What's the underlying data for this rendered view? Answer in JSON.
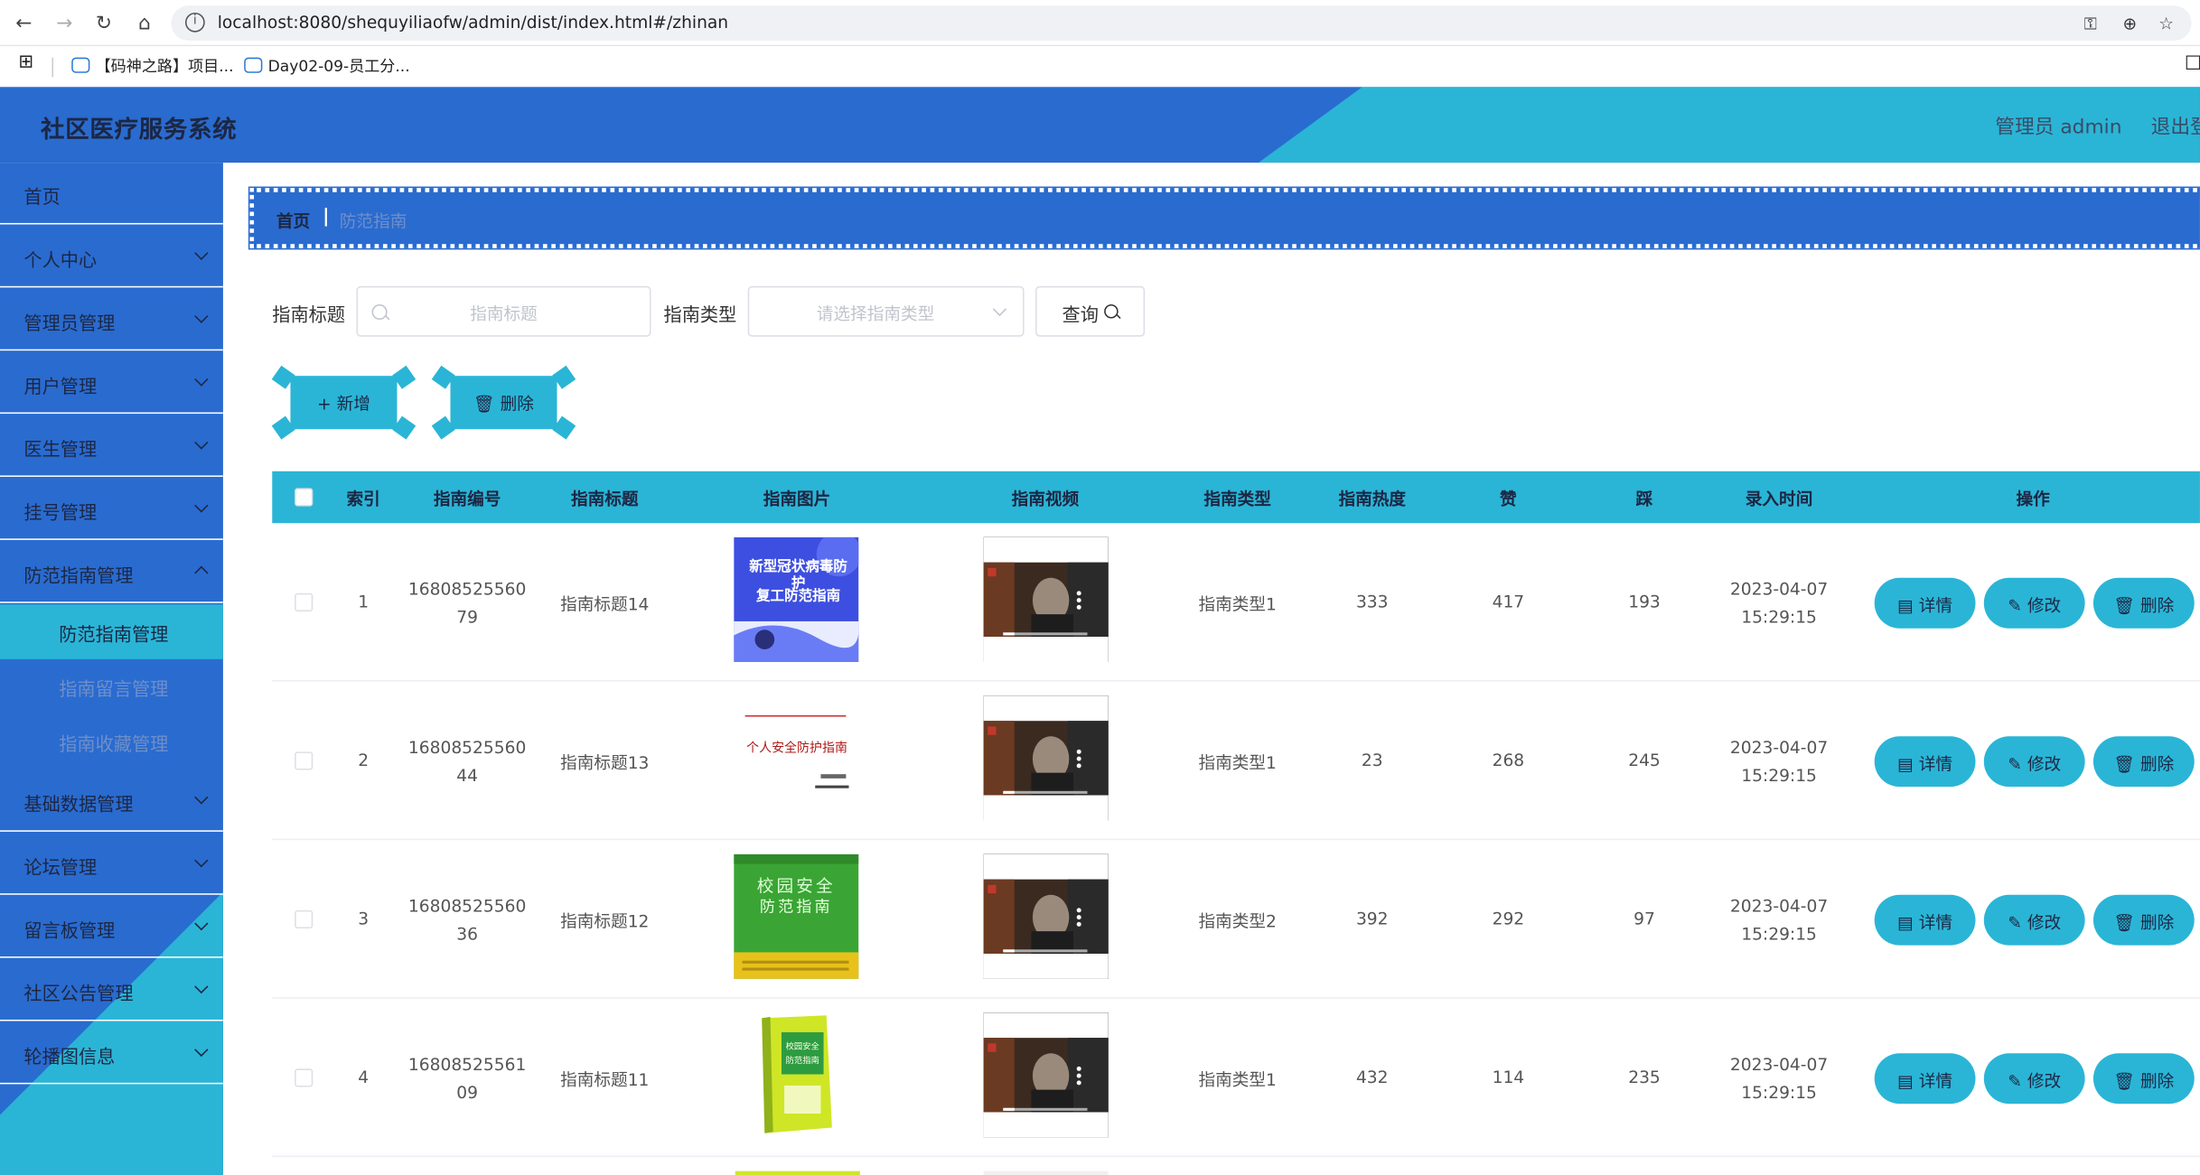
{
  "browser": {
    "url": "localhost:8080/shequyiliaofw/admin/dist/index.html#/zhinan",
    "bookmarks": [
      "【码神之路】项目...",
      "Day02-09-员工分..."
    ]
  },
  "header": {
    "title": "社区医疗服务系统",
    "user": "管理员 admin",
    "logout": "退出登"
  },
  "colors": {
    "primary": "#2a6bcf",
    "accent": "#2ab5d6",
    "text_dark": "#1c2744"
  },
  "sidebar": {
    "items": [
      {
        "label": "首页",
        "expandable": false
      },
      {
        "label": "个人中心",
        "expandable": true
      },
      {
        "label": "管理员管理",
        "expandable": true
      },
      {
        "label": "用户管理",
        "expandable": true
      },
      {
        "label": "医生管理",
        "expandable": true
      },
      {
        "label": "挂号管理",
        "expandable": true
      },
      {
        "label": "防范指南管理",
        "expandable": true,
        "expanded": true
      },
      {
        "label": "基础数据管理",
        "expandable": true
      },
      {
        "label": "论坛管理",
        "expandable": true
      },
      {
        "label": "留言板管理",
        "expandable": true
      },
      {
        "label": "社区公告管理",
        "expandable": true
      },
      {
        "label": "轮播图信息",
        "expandable": true
      }
    ],
    "subitems": [
      {
        "label": "防范指南管理",
        "active": true
      },
      {
        "label": "指南留言管理",
        "active": false
      },
      {
        "label": "指南收藏管理",
        "active": false
      }
    ]
  },
  "breadcrumb": {
    "home": "首页",
    "separator": "|",
    "current": "防范指南"
  },
  "search": {
    "title_label": "指南标题",
    "title_placeholder": "指南标题",
    "type_label": "指南类型",
    "type_placeholder": "请选择指南类型",
    "query_label": "查询"
  },
  "actions": {
    "add_label": "+ 新增",
    "delete_label": "删除"
  },
  "table": {
    "headers": [
      "索引",
      "指南编号",
      "指南标题",
      "指南图片",
      "指南视频",
      "指南类型",
      "指南热度",
      "赞",
      "踩",
      "录入时间",
      "操作"
    ],
    "row_buttons": [
      "详情",
      "修改",
      "删除"
    ],
    "rows": [
      {
        "index": "1",
        "code_1": "16808525560",
        "code_2": "79",
        "title": "指南标题14",
        "image": "blue-poster",
        "image_text_1": "新型冠状病毒防护",
        "image_text_2": "复工防范指南",
        "type": "指南类型1",
        "heat": "333",
        "likes": "417",
        "dislikes": "193",
        "date": "2023-04-07",
        "time": "15:29:15"
      },
      {
        "index": "2",
        "code_1": "16808525560",
        "code_2": "44",
        "title": "指南标题13",
        "image": "white-doc",
        "image_text_1": "个人安全防护指南",
        "image_text_2": "",
        "type": "指南类型1",
        "heat": "23",
        "likes": "268",
        "dislikes": "245",
        "date": "2023-04-07",
        "time": "15:29:15"
      },
      {
        "index": "3",
        "code_1": "16808525560",
        "code_2": "36",
        "title": "指南标题12",
        "image": "green-book",
        "image_text_1": "校园安全",
        "image_text_2": "防范指南",
        "type": "指南类型2",
        "heat": "392",
        "likes": "292",
        "dislikes": "97",
        "date": "2023-04-07",
        "time": "15:29:15"
      },
      {
        "index": "4",
        "code_1": "16808525561",
        "code_2": "09",
        "title": "指南标题11",
        "image": "yellow-book",
        "image_text_1": "校园安全",
        "image_text_2": "防范指南",
        "type": "指南类型1",
        "heat": "432",
        "likes": "114",
        "dislikes": "235",
        "date": "2023-04-07",
        "time": "15:29:15"
      }
    ]
  }
}
